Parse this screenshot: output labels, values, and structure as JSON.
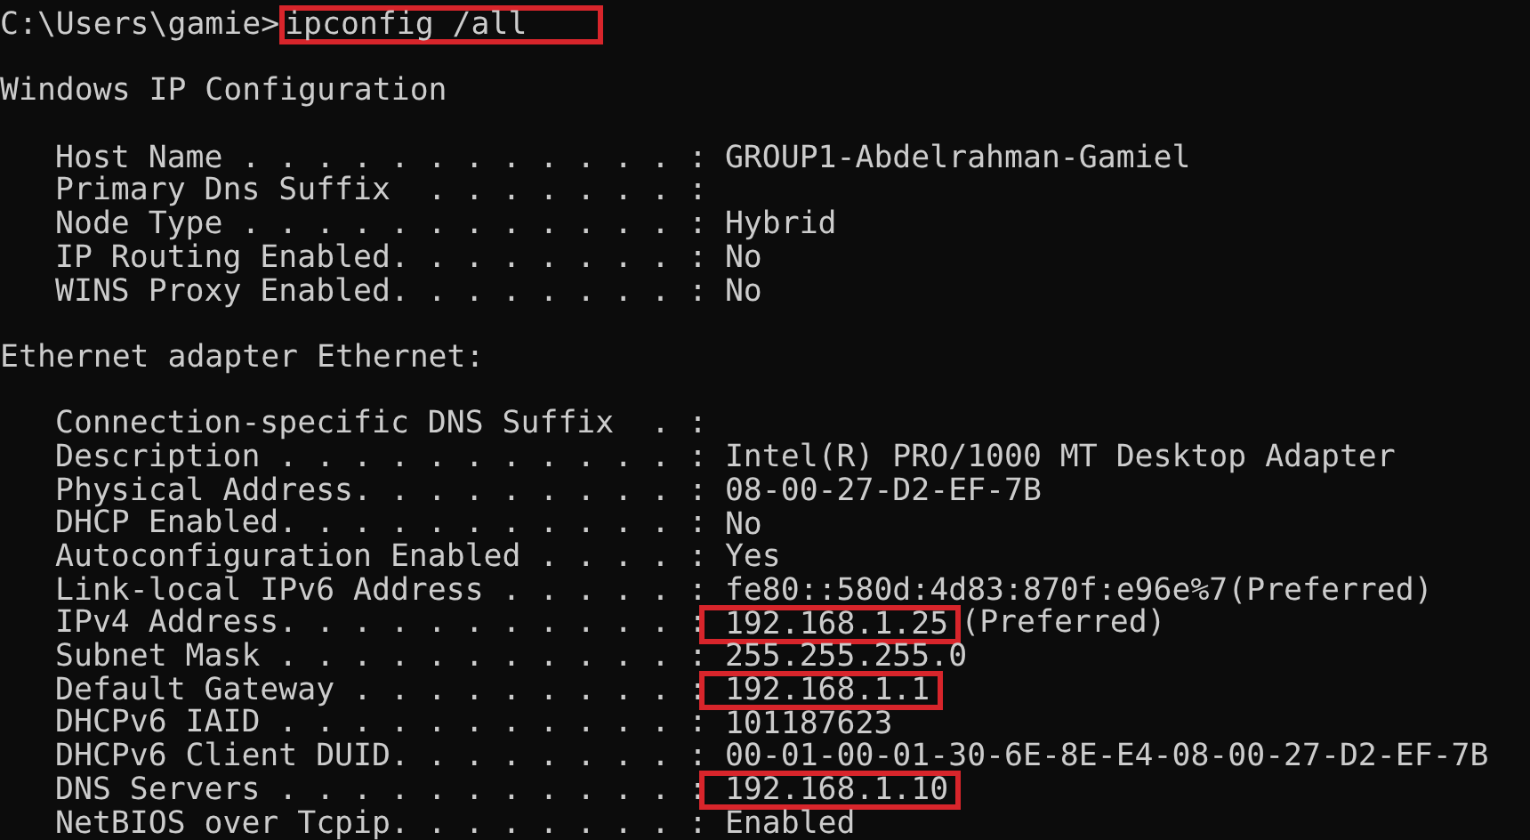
{
  "prompt": {
    "path": "C:\\Users\\gamie>",
    "command": "ipconfig /all",
    "highlighted": true
  },
  "sections": [
    {
      "title": "Windows IP Configuration",
      "entries": [
        {
          "label": "Host Name . . . . . . . . . . . . :",
          "value": "GROUP1-Abdelrahman-Gamiel"
        },
        {
          "label": "Primary Dns Suffix  . . . . . . . :"
        },
        {
          "label": "Node Type . . . . . . . . . . . . :",
          "value": "Hybrid"
        },
        {
          "label": "IP Routing Enabled. . . . . . . . :",
          "value": "No"
        },
        {
          "label": "WINS Proxy Enabled. . . . . . . . :",
          "value": "No"
        }
      ]
    },
    {
      "title": "Ethernet adapter Ethernet:",
      "entries": [
        {
          "label": "Connection-specific DNS Suffix  . :"
        },
        {
          "label": "Description . . . . . . . . . . . :",
          "value": "Intel(R) PRO/1000 MT Desktop Adapter"
        },
        {
          "label": "Physical Address. . . . . . . . . :",
          "value": "08-00-27-D2-EF-7B"
        },
        {
          "label": "DHCP Enabled. . . . . . . . . . . :",
          "value": "No"
        },
        {
          "label": "Autoconfiguration Enabled . . . . :",
          "value": "Yes"
        },
        {
          "label": "Link-local IPv6 Address . . . . . :",
          "value": "fe80::580d:4d83:870f:e96e%7(Preferred)"
        },
        {
          "label": "IPv4 Address. . . . . . . . . . . :",
          "value": "192.168.1.25",
          "suffix": "(Preferred)",
          "highlighted": true
        },
        {
          "label": "Subnet Mask . . . . . . . . . . . :",
          "value": "255.255.255.0"
        },
        {
          "label": "Default Gateway . . . . . . . . . :",
          "value": "192.168.1.1",
          "highlighted": true
        },
        {
          "label": "DHCPv6 IAID . . . . . . . . . . . :",
          "value": "101187623"
        },
        {
          "label": "DHCPv6 Client DUID. . . . . . . . :",
          "value": "00-01-00-01-30-6E-8E-E4-08-00-27-D2-EF-7B"
        },
        {
          "label": "DNS Servers . . . . . . . . . . . :",
          "value": "192.168.1.10",
          "highlighted": true
        },
        {
          "label": "NetBIOS over Tcpip. . . . . . . . :",
          "value": "Enabled"
        }
      ]
    }
  ]
}
